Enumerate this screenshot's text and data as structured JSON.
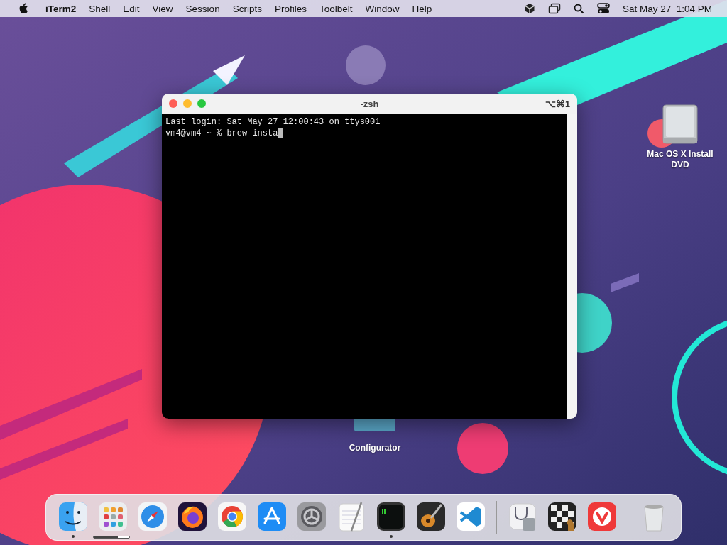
{
  "menu_bar": {
    "app_name": "iTerm2",
    "menus": [
      "Shell",
      "Edit",
      "View",
      "Session",
      "Scripts",
      "Profiles",
      "Toolbelt",
      "Window",
      "Help"
    ],
    "clock": "Sat May 27  1:04 PM"
  },
  "desktop_icons": [
    {
      "kind": "drive",
      "label": "Mac OS X Install DVD"
    },
    {
      "kind": "folder",
      "label": "Configurator"
    }
  ],
  "terminal": {
    "title": "-zsh",
    "shortcut": "⌥⌘1",
    "lines": [
      "Last login: Sat May 27 12:00:43 on ttys001",
      "vm4@vm4 ~ % brew insta"
    ]
  },
  "dock": {
    "sections": [
      {
        "items": [
          {
            "kind": "finder",
            "running": true
          },
          {
            "kind": "launchpad",
            "running": false,
            "level": 0.67
          },
          {
            "kind": "safari",
            "running": false
          },
          {
            "kind": "firefox",
            "running": false
          },
          {
            "kind": "chrome",
            "running": false
          },
          {
            "kind": "appstore",
            "running": false
          },
          {
            "kind": "settings",
            "running": false
          },
          {
            "kind": "textedit",
            "running": false
          },
          {
            "kind": "terminal",
            "running": true
          },
          {
            "kind": "garageband",
            "running": false
          },
          {
            "kind": "vscode",
            "running": false
          }
        ]
      },
      {
        "items": [
          {
            "kind": "diskutility",
            "running": false
          },
          {
            "kind": "chess",
            "running": false
          },
          {
            "kind": "vivaldi",
            "running": false
          }
        ]
      },
      {
        "items": [
          {
            "kind": "trash",
            "running": false
          }
        ]
      }
    ]
  }
}
